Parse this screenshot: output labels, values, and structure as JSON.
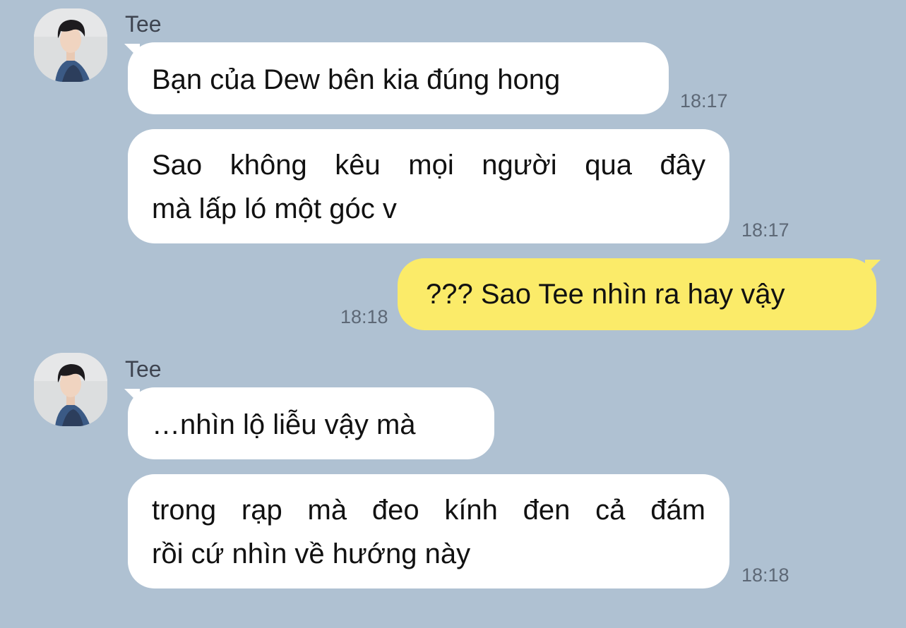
{
  "messages": [
    {
      "sender": "Tee",
      "text": "Bạn của Dew bên kia đúng hong",
      "time": "18:17"
    },
    {
      "text_line1": "Sao không kêu mọi người qua đây",
      "text_line2": "mà lấp ló một góc v",
      "time": "18:17"
    },
    {
      "text": "??? Sao Tee nhìn ra hay vậy",
      "time": "18:18"
    },
    {
      "sender": "Tee",
      "text": "…nhìn lộ liễu vậy mà",
      "time": ""
    },
    {
      "text_line1": "trong rạp mà đeo kính đen cả đám",
      "text_line2": "rồi cứ nhìn về hướng này",
      "time": "18:18"
    }
  ],
  "colors": {
    "background": "#afc1d2",
    "incoming_bubble": "#ffffff",
    "outgoing_bubble": "#fbeb69",
    "timestamp": "#5d6876"
  },
  "icons": {
    "avatar": "profile-photo"
  }
}
